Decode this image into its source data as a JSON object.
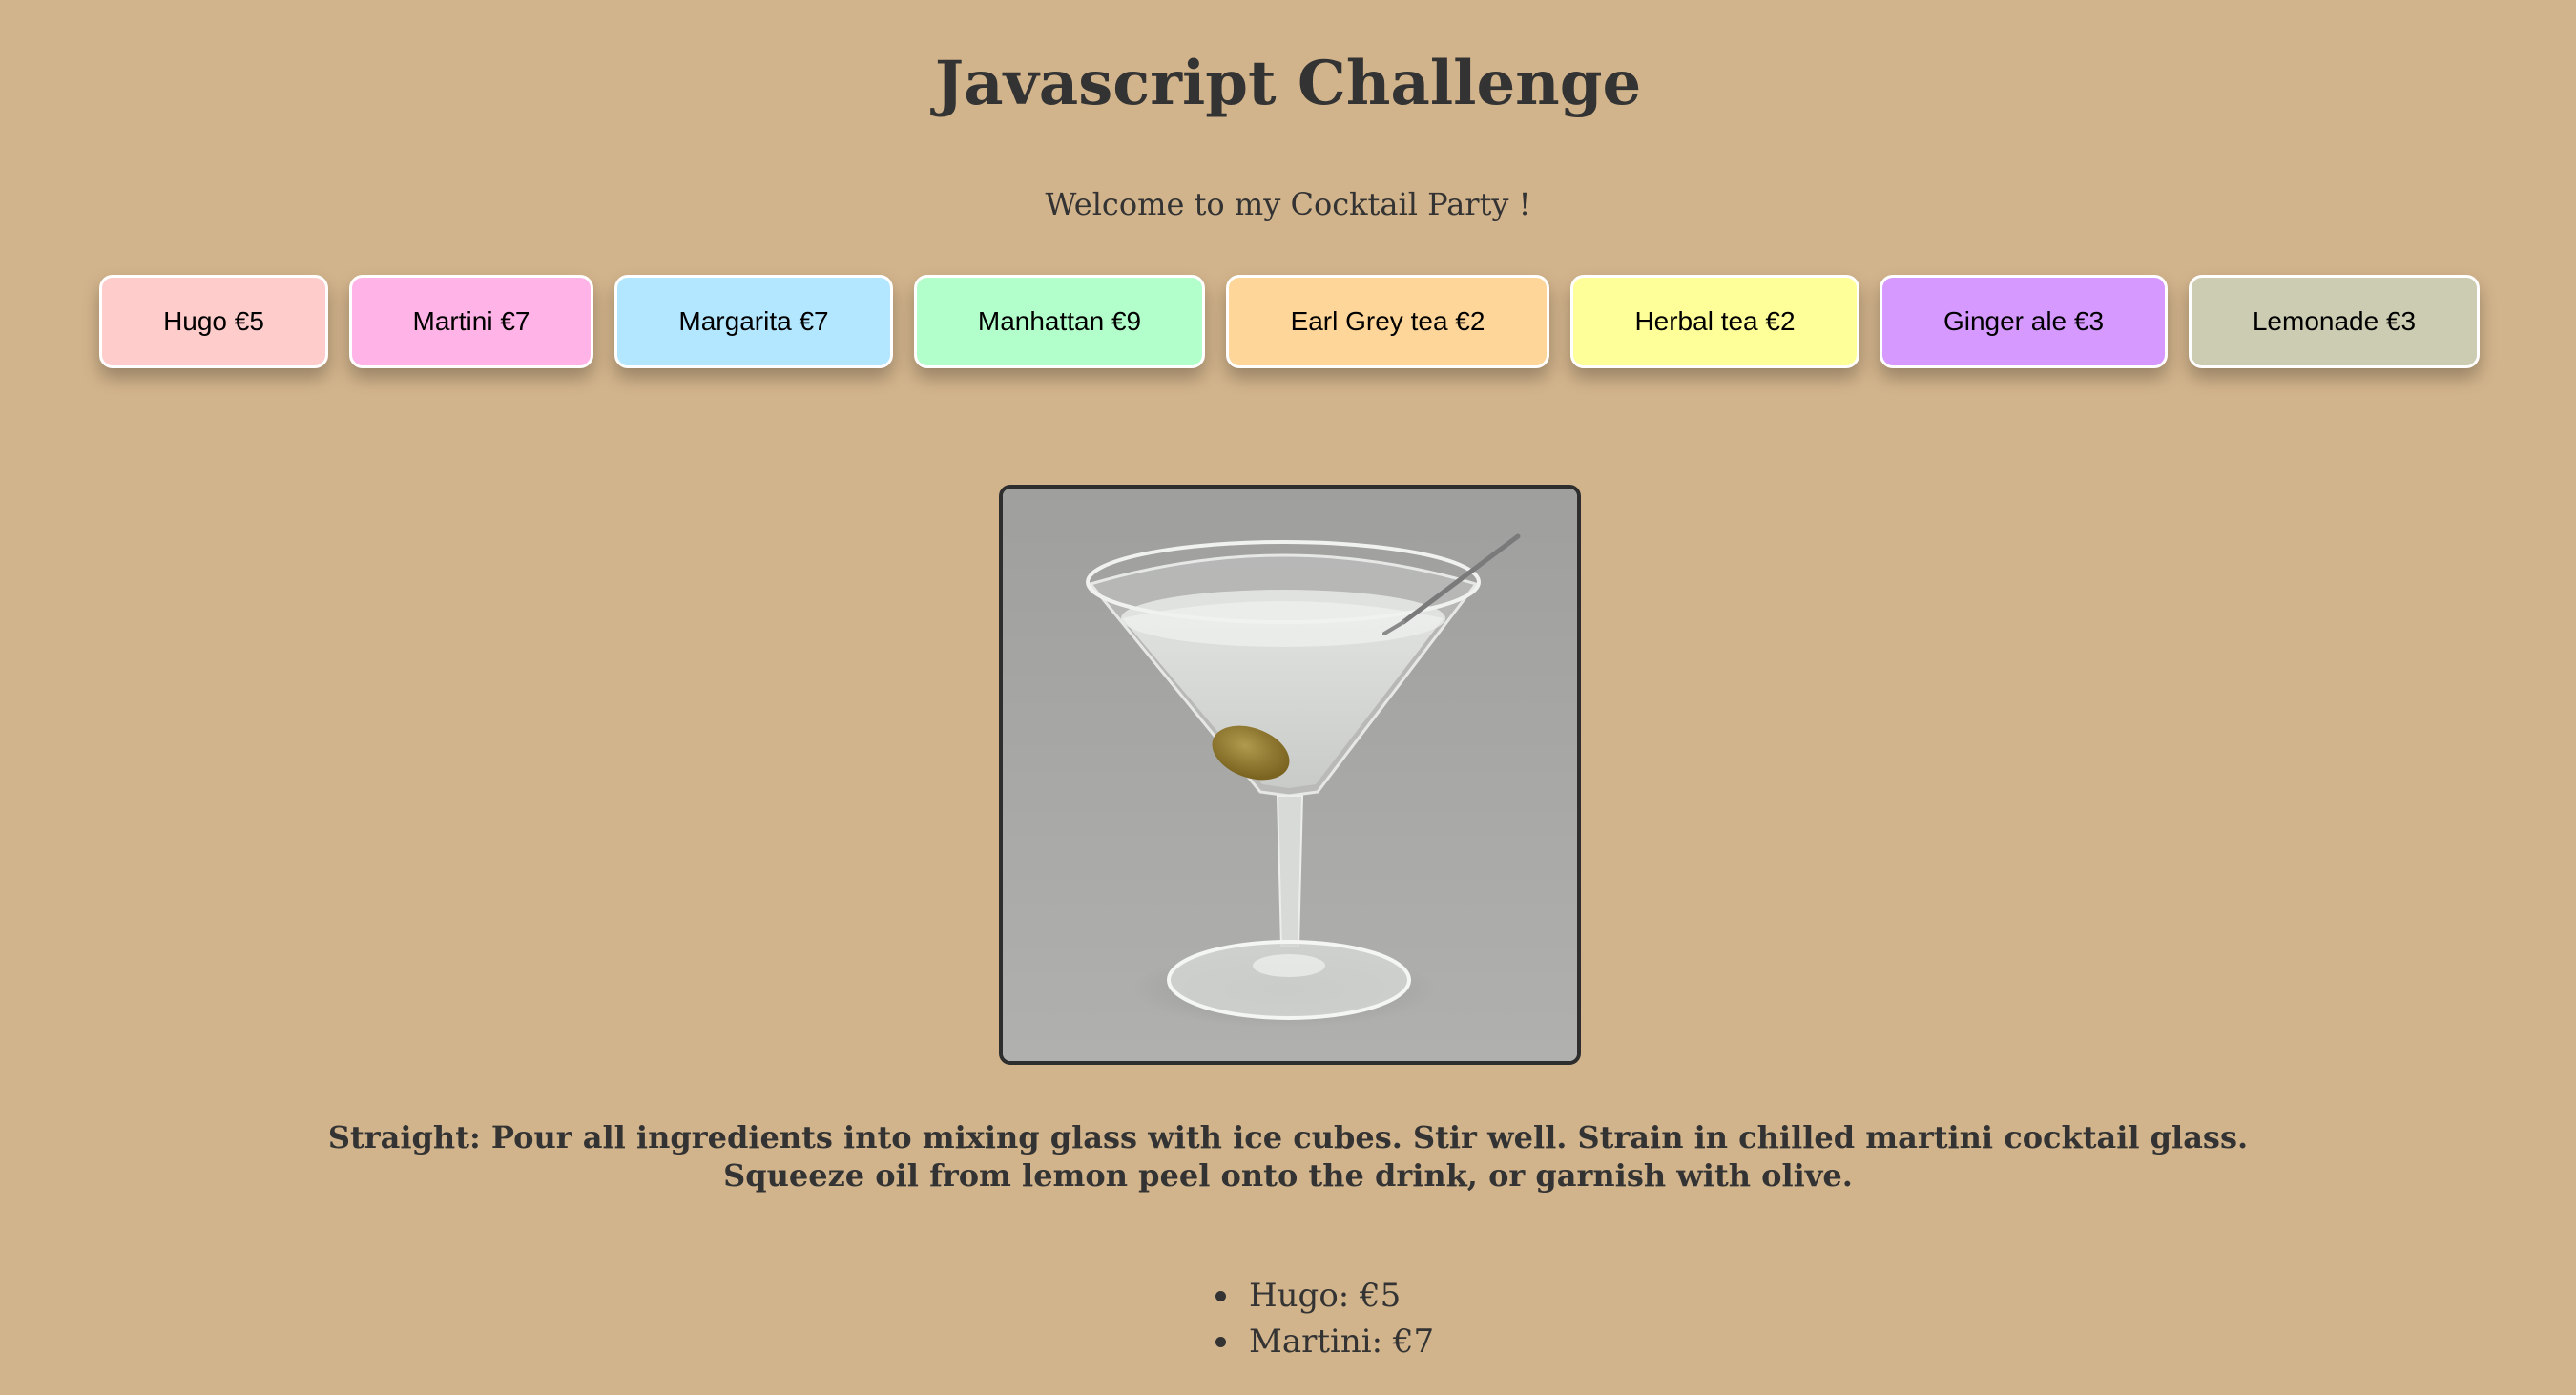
{
  "page": {
    "title": "Javascript Challenge",
    "subtitle": "Welcome to my Cocktail Party !"
  },
  "drinks": [
    {
      "label": "Hugo €5",
      "color": "#ffcccc"
    },
    {
      "label": "Martini €7",
      "color": "#ffb3e6"
    },
    {
      "label": "Margarita €7",
      "color": "#b3e6ff"
    },
    {
      "label": "Manhattan €9",
      "color": "#b3ffcc"
    },
    {
      "label": "Earl Grey tea €2",
      "color": "#ffd699"
    },
    {
      "label": "Herbal tea €2",
      "color": "#ffff99"
    },
    {
      "label": "Ginger ale €3",
      "color": "#d699ff"
    },
    {
      "label": "Lemonade €3",
      "color": "#ccccb3"
    }
  ],
  "selected_drink": {
    "image_icon": "martini-glass-photo",
    "instructions_line1": "Straight: Pour all ingredients into mixing glass with ice cubes. Stir well. Strain in chilled martini cocktail glass.",
    "instructions_line2": "Squeeze oil from lemon peel onto the drink, or garnish with olive."
  },
  "order": [
    {
      "label": "Hugo: €5"
    },
    {
      "label": "Martini: €7"
    }
  ],
  "colors": {
    "background": "#d2b48c",
    "text": "#333333",
    "button_border": "#ffffff"
  }
}
